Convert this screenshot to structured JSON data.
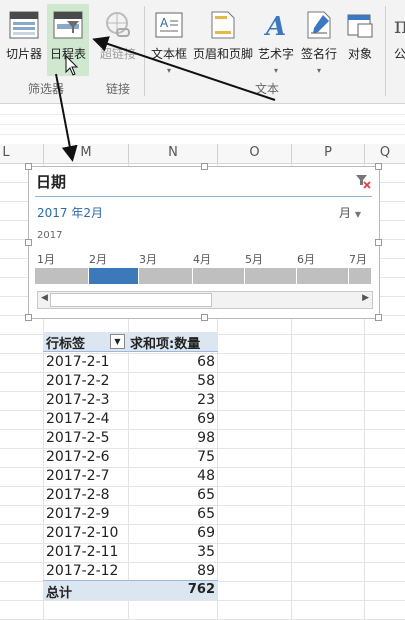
{
  "ribbon": {
    "buttons": [
      {
        "label": "切片器",
        "icon": "slicer-icon"
      },
      {
        "label": "日程表",
        "icon": "timeline-icon"
      },
      {
        "label": "超链接",
        "icon": "hyperlink-icon"
      },
      {
        "label": "文本框",
        "icon": "textbox-icon"
      },
      {
        "label": "页眉和页脚",
        "icon": "header-footer-icon"
      },
      {
        "label": "艺术字",
        "icon": "wordart-icon"
      },
      {
        "label": "签名行",
        "icon": "signature-line-icon"
      },
      {
        "label": "对象",
        "icon": "object-icon"
      },
      {
        "label": "公",
        "icon": "equation-icon"
      }
    ],
    "groups": [
      "筛选器",
      "链接",
      "文本"
    ]
  },
  "columns": [
    "L",
    "M",
    "N",
    "O",
    "P",
    "Q"
  ],
  "timeline": {
    "title": "日期",
    "range": "2017 年2月",
    "level": "月",
    "year": "2017",
    "months": [
      "1月",
      "2月",
      "3月",
      "4月",
      "5月",
      "6月",
      "7月"
    ],
    "selected_month": "2月"
  },
  "pivot": {
    "row_header": "行标签",
    "value_header": "求和项:数量",
    "rows": [
      {
        "date": "2017-2-1",
        "value": "68"
      },
      {
        "date": "2017-2-2",
        "value": "58"
      },
      {
        "date": "2017-2-3",
        "value": "23"
      },
      {
        "date": "2017-2-4",
        "value": "69"
      },
      {
        "date": "2017-2-5",
        "value": "98"
      },
      {
        "date": "2017-2-6",
        "value": "75"
      },
      {
        "date": "2017-2-7",
        "value": "48"
      },
      {
        "date": "2017-2-8",
        "value": "65"
      },
      {
        "date": "2017-2-9",
        "value": "65"
      },
      {
        "date": "2017-2-10",
        "value": "69"
      },
      {
        "date": "2017-2-11",
        "value": "35"
      },
      {
        "date": "2017-2-12",
        "value": "89"
      }
    ],
    "total_label": "总计",
    "total_value": "762"
  },
  "colors": {
    "accent": "#3c79b8",
    "pivot_header": "#dce6f1",
    "active_button": "#cfe8cf"
  }
}
